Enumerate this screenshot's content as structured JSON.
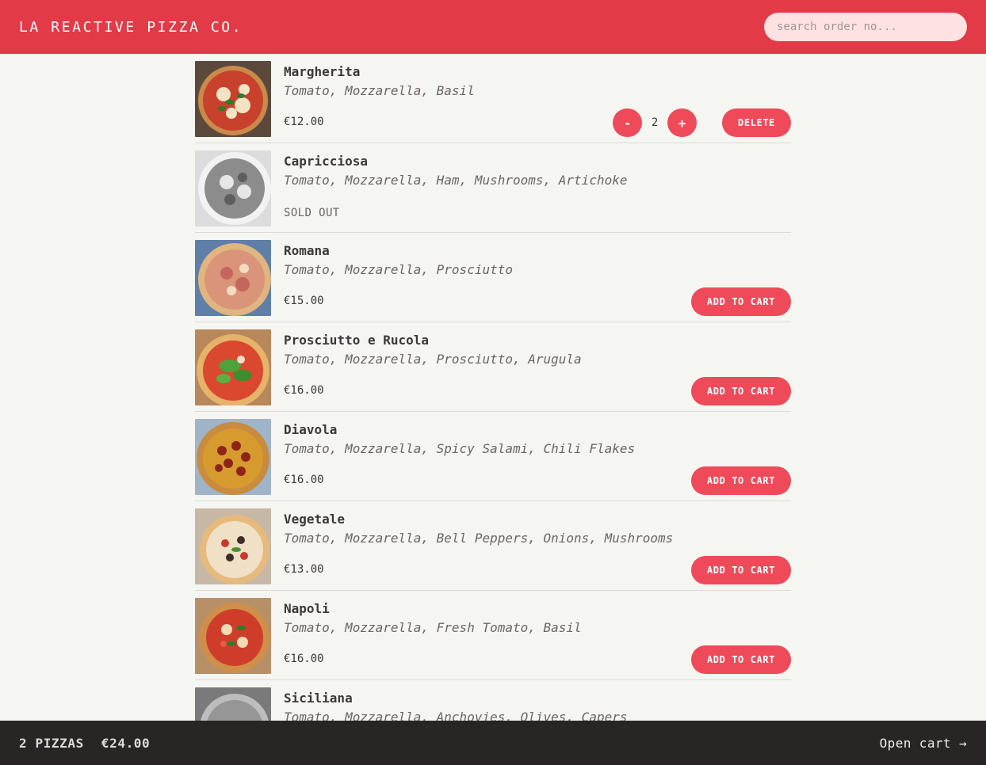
{
  "header": {
    "brand": "LA REACTIVE PIZZA CO.",
    "search_placeholder": "search order no..."
  },
  "menu": [
    {
      "name": "Margherita",
      "ingredients": "Tomato, Mozzarella, Basil",
      "price": "€12.00",
      "in_cart": true,
      "quantity": "2",
      "delete_label": "DELETE",
      "decrement_label": "-",
      "increment_label": "+"
    },
    {
      "name": "Capricciosa",
      "ingredients": "Tomato, Mozzarella, Ham, Mushrooms, Artichoke",
      "sold_out": "SOLD OUT"
    },
    {
      "name": "Romana",
      "ingredients": "Tomato, Mozzarella, Prosciutto",
      "price": "€15.00",
      "button": "ADD TO CART"
    },
    {
      "name": "Prosciutto e Rucola",
      "ingredients": "Tomato, Mozzarella, Prosciutto, Arugula",
      "price": "€16.00",
      "button": "ADD TO CART"
    },
    {
      "name": "Diavola",
      "ingredients": "Tomato, Mozzarella, Spicy Salami, Chili Flakes",
      "price": "€16.00",
      "button": "ADD TO CART"
    },
    {
      "name": "Vegetale",
      "ingredients": "Tomato, Mozzarella, Bell Peppers, Onions, Mushrooms",
      "price": "€13.00",
      "button": "ADD TO CART"
    },
    {
      "name": "Napoli",
      "ingredients": "Tomato, Mozzarella, Fresh Tomato, Basil",
      "price": "€16.00",
      "button": "ADD TO CART"
    },
    {
      "name": "Siciliana",
      "ingredients": "Tomato, Mozzarella, Anchovies, Olives, Capers"
    }
  ],
  "footer": {
    "count": "2 PIZZAS",
    "total": "€24.00",
    "open_cart": "Open cart →"
  },
  "colors": {
    "brand_red": "#e33a47",
    "button_red": "#ef4a59",
    "background": "#f5f5f2",
    "footer_bg": "#292524"
  }
}
